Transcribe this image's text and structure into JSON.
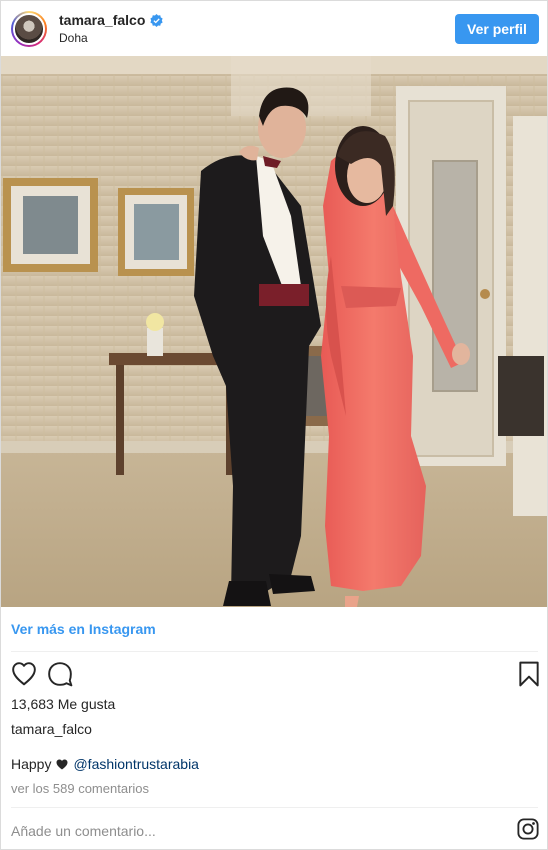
{
  "header": {
    "username": "tamara_falco",
    "location": "Doha",
    "follow_label": "Ver perfil"
  },
  "post": {
    "view_more_label": "Ver más en Instagram",
    "likes_text": "13,683 Me gusta",
    "caption_user": "tamara_falco",
    "caption_text": "Happy",
    "caption_mention": "@fashiontrustarabia",
    "comments_link": "ver los 589 comentarios",
    "add_comment_placeholder": "Añade un comentario..."
  },
  "icons": {
    "like": "heart-icon",
    "comment": "comment-icon",
    "save": "bookmark-icon",
    "instagram": "instagram-logo-icon",
    "verified": "verified-badge-icon",
    "caption_heart": "black-heart-icon"
  },
  "colors": {
    "accent": "#3897f0",
    "mention": "#003569",
    "muted": "#8e8e8e",
    "text": "#262626"
  }
}
